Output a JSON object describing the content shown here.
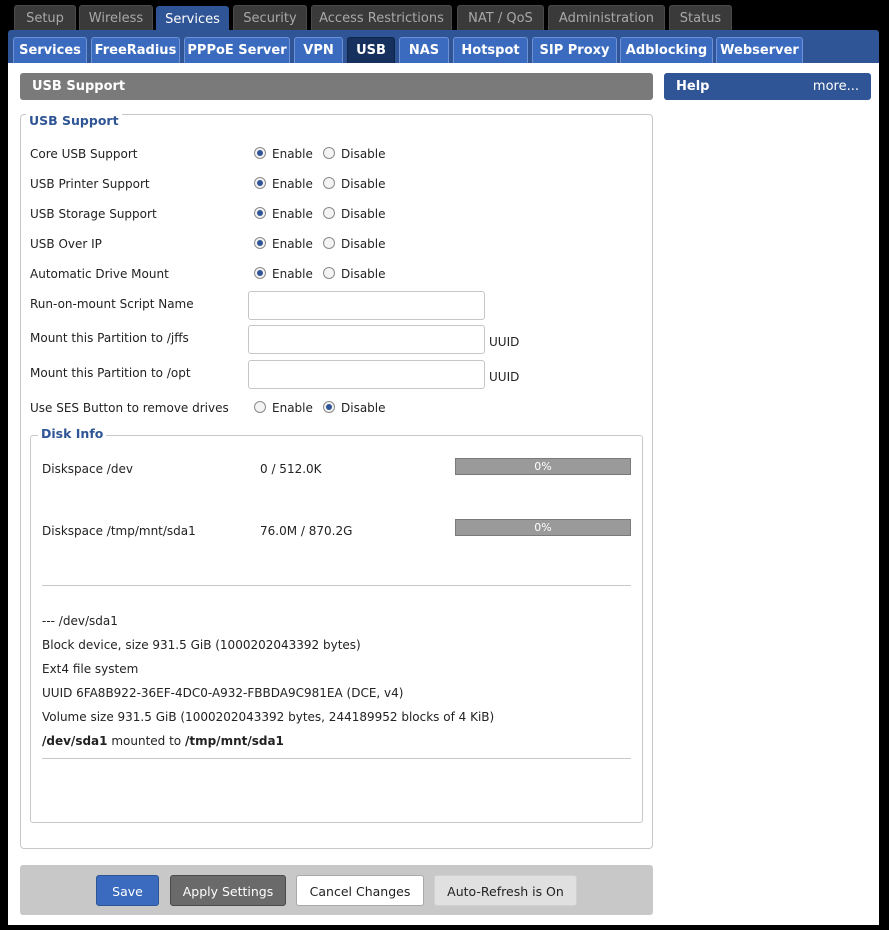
{
  "top_tabs": [
    "Setup",
    "Wireless",
    "Services",
    "Security",
    "Access Restrictions",
    "NAT / QoS",
    "Administration",
    "Status"
  ],
  "sub_tabs": [
    "Services",
    "FreeRadius",
    "PPPoE Server",
    "VPN",
    "USB",
    "NAS",
    "Hotspot",
    "SIP Proxy",
    "Adblocking",
    "Webserver"
  ],
  "section_title": "USB Support",
  "help": {
    "title": "Help",
    "more": "more..."
  },
  "usb_legend": "USB Support",
  "radio_rows": [
    {
      "label": "Core USB Support",
      "enable": "Enable",
      "disable": "Disable",
      "selected": "enable"
    },
    {
      "label": "USB Printer Support",
      "enable": "Enable",
      "disable": "Disable",
      "selected": "enable"
    },
    {
      "label": "USB Storage Support",
      "enable": "Enable",
      "disable": "Disable",
      "selected": "enable"
    },
    {
      "label": "USB Over IP",
      "enable": "Enable",
      "disable": "Disable",
      "selected": "enable"
    },
    {
      "label": "Automatic Drive Mount",
      "enable": "Enable",
      "disable": "Disable",
      "selected": "enable"
    }
  ],
  "fields": {
    "script_label": "Run-on-mount Script Name",
    "script_value": "",
    "jffs_label": "Mount this Partition to /jffs",
    "jffs_value": "",
    "jffs_suffix": "UUID",
    "opt_label": "Mount this Partition to /opt",
    "opt_value": "",
    "opt_suffix": "UUID"
  },
  "ses": {
    "label": "Use SES Button to remove drives",
    "enable": "Enable",
    "disable": "Disable",
    "selected": "disable"
  },
  "disk_info": {
    "legend": "Disk Info",
    "rows": [
      {
        "label": "Diskspace /dev",
        "value": "0 / 512.0K",
        "percent_label": "0%",
        "percent": 0
      },
      {
        "label": "Diskspace /tmp/mnt/sda1",
        "value": "76.0M / 870.2G",
        "percent_label": "0%",
        "percent": 0
      }
    ],
    "lines": [
      "--- /dev/sda1",
      "Block device, size 931.5 GiB (1000202043392 bytes)",
      "Ext4 file system",
      "UUID 6FA8B922-36EF-4DC0-A932-FBBDA9C981EA (DCE, v4)",
      "Volume size 931.5 GiB (1000202043392 bytes, 244189952 blocks of 4 KiB)"
    ],
    "mount": {
      "device": "/dev/sda1",
      "mid": "mounted to",
      "target": "/tmp/mnt/sda1"
    }
  },
  "buttons": {
    "save": "Save",
    "apply": "Apply Settings",
    "cancel": "Cancel Changes",
    "refresh": "Auto-Refresh is On"
  },
  "colors": {
    "accent": "#2f5596",
    "tab_blue": "#3a6bbf",
    "section_grey": "#7a7a7a"
  }
}
